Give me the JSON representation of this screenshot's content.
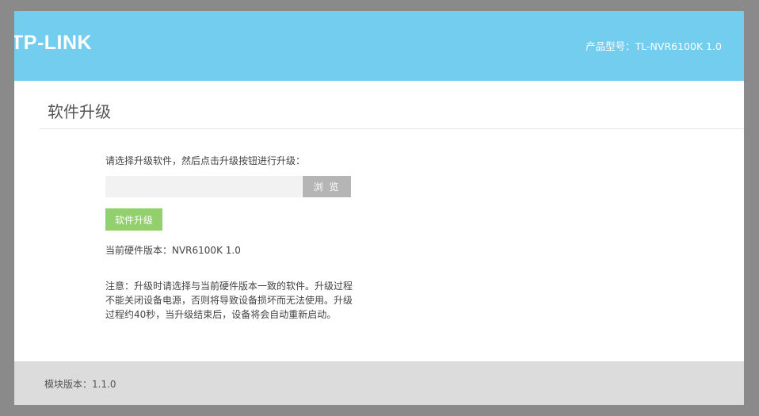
{
  "header": {
    "logo_text": "TP-LINK",
    "model_label": "产品型号：TL-NVR6100K 1.0"
  },
  "page": {
    "title": "软件升级"
  },
  "upgrade_form": {
    "instruction": "请选择升级软件，然后点击升级按钮进行升级：",
    "file_input_value": "",
    "browse_label": "浏 览",
    "upgrade_label": "软件升级",
    "hardware_version": "当前硬件版本：NVR6100K 1.0",
    "note_lines": [
      "注意：升级时请选择与当前硬件版本一致的软件。升级过程",
      "不能关闭设备电源，否则将导致设备损坏而无法使用。升级",
      "过程约40秒，当升级结束后，设备将会自动重新启动。"
    ]
  },
  "footer": {
    "module_version": "模块版本：1.1.0"
  },
  "colors": {
    "header_bg": "#72cdee",
    "upgrade_button": "#92d06d",
    "browse_button": "#b5b5b5",
    "footer_bg": "#dcdcdc"
  }
}
